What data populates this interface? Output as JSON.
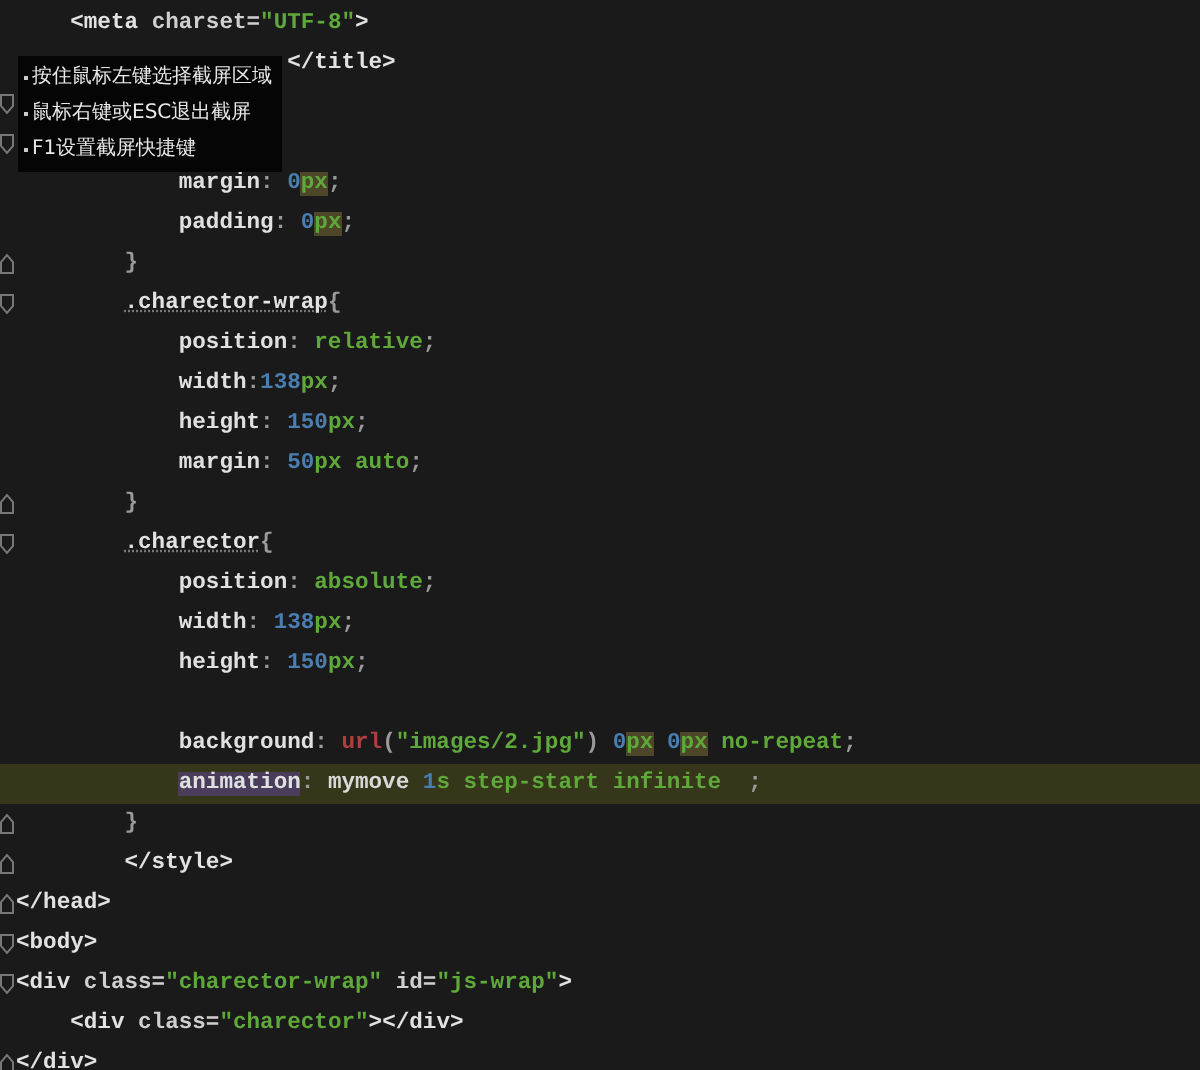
{
  "editor": {
    "lines": [
      {
        "kind": "code",
        "tokens": [
          {
            "kind": "tag",
            "text": "    <meta"
          },
          {
            "kind": "attr",
            "text": " charset="
          },
          {
            "kind": "str",
            "text": "\"UTF-8\""
          },
          {
            "kind": "tag",
            "text": ">"
          }
        ]
      },
      {
        "kind": "code",
        "tokens": [
          {
            "kind": "tag",
            "text": "                    </title>"
          }
        ]
      },
      {
        "kind": "fold-start"
      },
      {
        "kind": "fold-start"
      },
      {
        "kind": "code",
        "tokens": [
          {
            "kind": "prop",
            "text": "            margin"
          },
          {
            "kind": "punct",
            "text": ": "
          },
          {
            "kind": "num",
            "text": "0"
          },
          {
            "kind": "unit",
            "text": "px",
            "marked": true
          },
          {
            "kind": "punct",
            "text": ";"
          }
        ]
      },
      {
        "kind": "code",
        "tokens": [
          {
            "kind": "prop",
            "text": "            padding"
          },
          {
            "kind": "punct",
            "text": ": "
          },
          {
            "kind": "num",
            "text": "0"
          },
          {
            "kind": "unit",
            "text": "px",
            "marked": true
          },
          {
            "kind": "punct",
            "text": ";"
          }
        ]
      },
      {
        "kind": "fold-end",
        "tokens": [
          {
            "kind": "punct",
            "text": "        }"
          }
        ]
      },
      {
        "kind": "fold-start",
        "tokens": [
          {
            "kind": "sel",
            "text": "        .charector-wrap"
          },
          {
            "kind": "punct",
            "text": "{"
          }
        ]
      },
      {
        "kind": "code",
        "tokens": [
          {
            "kind": "prop",
            "text": "            position"
          },
          {
            "kind": "punct",
            "text": ": "
          },
          {
            "kind": "val",
            "text": "relative"
          },
          {
            "kind": "punct",
            "text": ";"
          }
        ]
      },
      {
        "kind": "code",
        "tokens": [
          {
            "kind": "prop",
            "text": "            width"
          },
          {
            "kind": "punct",
            "text": ":"
          },
          {
            "kind": "num",
            "text": "138"
          },
          {
            "kind": "unit",
            "text": "px"
          },
          {
            "kind": "punct",
            "text": ";"
          }
        ]
      },
      {
        "kind": "code",
        "tokens": [
          {
            "kind": "prop",
            "text": "            height"
          },
          {
            "kind": "punct",
            "text": ": "
          },
          {
            "kind": "num",
            "text": "150"
          },
          {
            "kind": "unit",
            "text": "px"
          },
          {
            "kind": "punct",
            "text": ";"
          }
        ]
      },
      {
        "kind": "code",
        "tokens": [
          {
            "kind": "prop",
            "text": "            margin"
          },
          {
            "kind": "punct",
            "text": ": "
          },
          {
            "kind": "num",
            "text": "50"
          },
          {
            "kind": "unit",
            "text": "px"
          },
          {
            "kind": "val",
            "text": " auto"
          },
          {
            "kind": "punct",
            "text": ";"
          }
        ]
      },
      {
        "kind": "fold-end",
        "tokens": [
          {
            "kind": "punct",
            "text": "        }"
          }
        ]
      },
      {
        "kind": "fold-start",
        "tokens": [
          {
            "kind": "sel",
            "text": "        .charector"
          },
          {
            "kind": "punct",
            "text": "{"
          }
        ]
      },
      {
        "kind": "code",
        "tokens": [
          {
            "kind": "prop",
            "text": "            position"
          },
          {
            "kind": "punct",
            "text": ": "
          },
          {
            "kind": "val",
            "text": "absolute"
          },
          {
            "kind": "punct",
            "text": ";"
          }
        ]
      },
      {
        "kind": "code",
        "tokens": [
          {
            "kind": "prop",
            "text": "            width"
          },
          {
            "kind": "punct",
            "text": ": "
          },
          {
            "kind": "num",
            "text": "138"
          },
          {
            "kind": "unit",
            "text": "px"
          },
          {
            "kind": "punct",
            "text": ";"
          }
        ]
      },
      {
        "kind": "code",
        "tokens": [
          {
            "kind": "prop",
            "text": "            height"
          },
          {
            "kind": "punct",
            "text": ": "
          },
          {
            "kind": "num",
            "text": "150"
          },
          {
            "kind": "unit",
            "text": "px"
          },
          {
            "kind": "punct",
            "text": ";"
          }
        ]
      },
      {
        "kind": "blank"
      },
      {
        "kind": "code",
        "tokens": [
          {
            "kind": "prop",
            "text": "            background"
          },
          {
            "kind": "punct",
            "text": ": "
          },
          {
            "kind": "fn",
            "text": "url"
          },
          {
            "kind": "punct",
            "text": "("
          },
          {
            "kind": "str",
            "text": "\"images/2.jpg\""
          },
          {
            "kind": "punct",
            "text": ")"
          },
          {
            "kind": "num",
            "text": " 0"
          },
          {
            "kind": "unit",
            "text": "px",
            "marked": true
          },
          {
            "kind": "num",
            "text": " 0"
          },
          {
            "kind": "unit",
            "text": "px",
            "marked": true
          },
          {
            "kind": "val",
            "text": " no-repeat"
          },
          {
            "kind": "punct",
            "text": ";"
          }
        ]
      },
      {
        "kind": "code",
        "current": true,
        "tokens": [
          {
            "kind": "prop",
            "text": "            animation",
            "marked": true
          },
          {
            "kind": "punct",
            "text": ": "
          },
          {
            "kind": "text",
            "text": "mymove "
          },
          {
            "kind": "num",
            "text": "1"
          },
          {
            "kind": "val",
            "text": "s step-start infinite"
          },
          {
            "kind": "punct",
            "text": "  ;"
          }
        ]
      },
      {
        "kind": "fold-end",
        "tokens": [
          {
            "kind": "punct",
            "text": "        }"
          }
        ]
      },
      {
        "kind": "fold-end",
        "tokens": [
          {
            "kind": "tag",
            "text": "        </style>"
          }
        ]
      },
      {
        "kind": "fold-end",
        "tokens": [
          {
            "kind": "tag",
            "text": "</head>"
          }
        ]
      },
      {
        "kind": "fold-start",
        "tokens": [
          {
            "kind": "tag",
            "text": "<body>"
          }
        ]
      },
      {
        "kind": "fold-start",
        "tokens": [
          {
            "kind": "tag",
            "text": "<div"
          },
          {
            "kind": "attr",
            "text": " class="
          },
          {
            "kind": "str",
            "text": "\"charector-wrap\""
          },
          {
            "kind": "attr",
            "text": " id="
          },
          {
            "kind": "str",
            "text": "\"js-wrap\""
          },
          {
            "kind": "tag",
            "text": ">"
          }
        ]
      },
      {
        "kind": "code",
        "tokens": [
          {
            "kind": "tag",
            "text": "    <div"
          },
          {
            "kind": "attr",
            "text": " class="
          },
          {
            "kind": "str",
            "text": "\"charector\""
          },
          {
            "kind": "tag",
            "text": "></div>"
          }
        ]
      },
      {
        "kind": "fold-end",
        "tokens": [
          {
            "kind": "tag",
            "text": "</div>"
          }
        ]
      }
    ]
  },
  "screenshot_hint": {
    "lines": [
      "按住鼠标左键选择截屏区域",
      "鼠标右键或ESC退出截屏",
      "F1设置截屏快捷键"
    ]
  }
}
